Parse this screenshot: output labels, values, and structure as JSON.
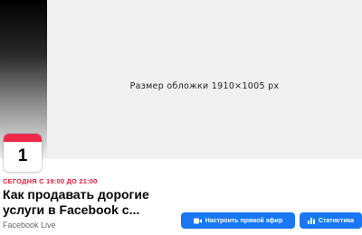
{
  "cover": {
    "size_label": "Размер обложки 1910×1005 px"
  },
  "calendar": {
    "day": "1"
  },
  "event": {
    "time": "СЕГОДНЯ С 19:00 ДО 21:00",
    "title": "Как продавать дорогие услуги в Facebook с...",
    "host": "Facebook Live"
  },
  "actions": {
    "live_label": "Настроить прямой эфир",
    "stats_label": "Статистика"
  },
  "colors": {
    "accent": "#1877f2",
    "calendar_header": "#f0284a",
    "time_text": "#e41e3f"
  },
  "icons": {
    "live": "video-camera-icon",
    "stats": "bar-chart-icon"
  }
}
